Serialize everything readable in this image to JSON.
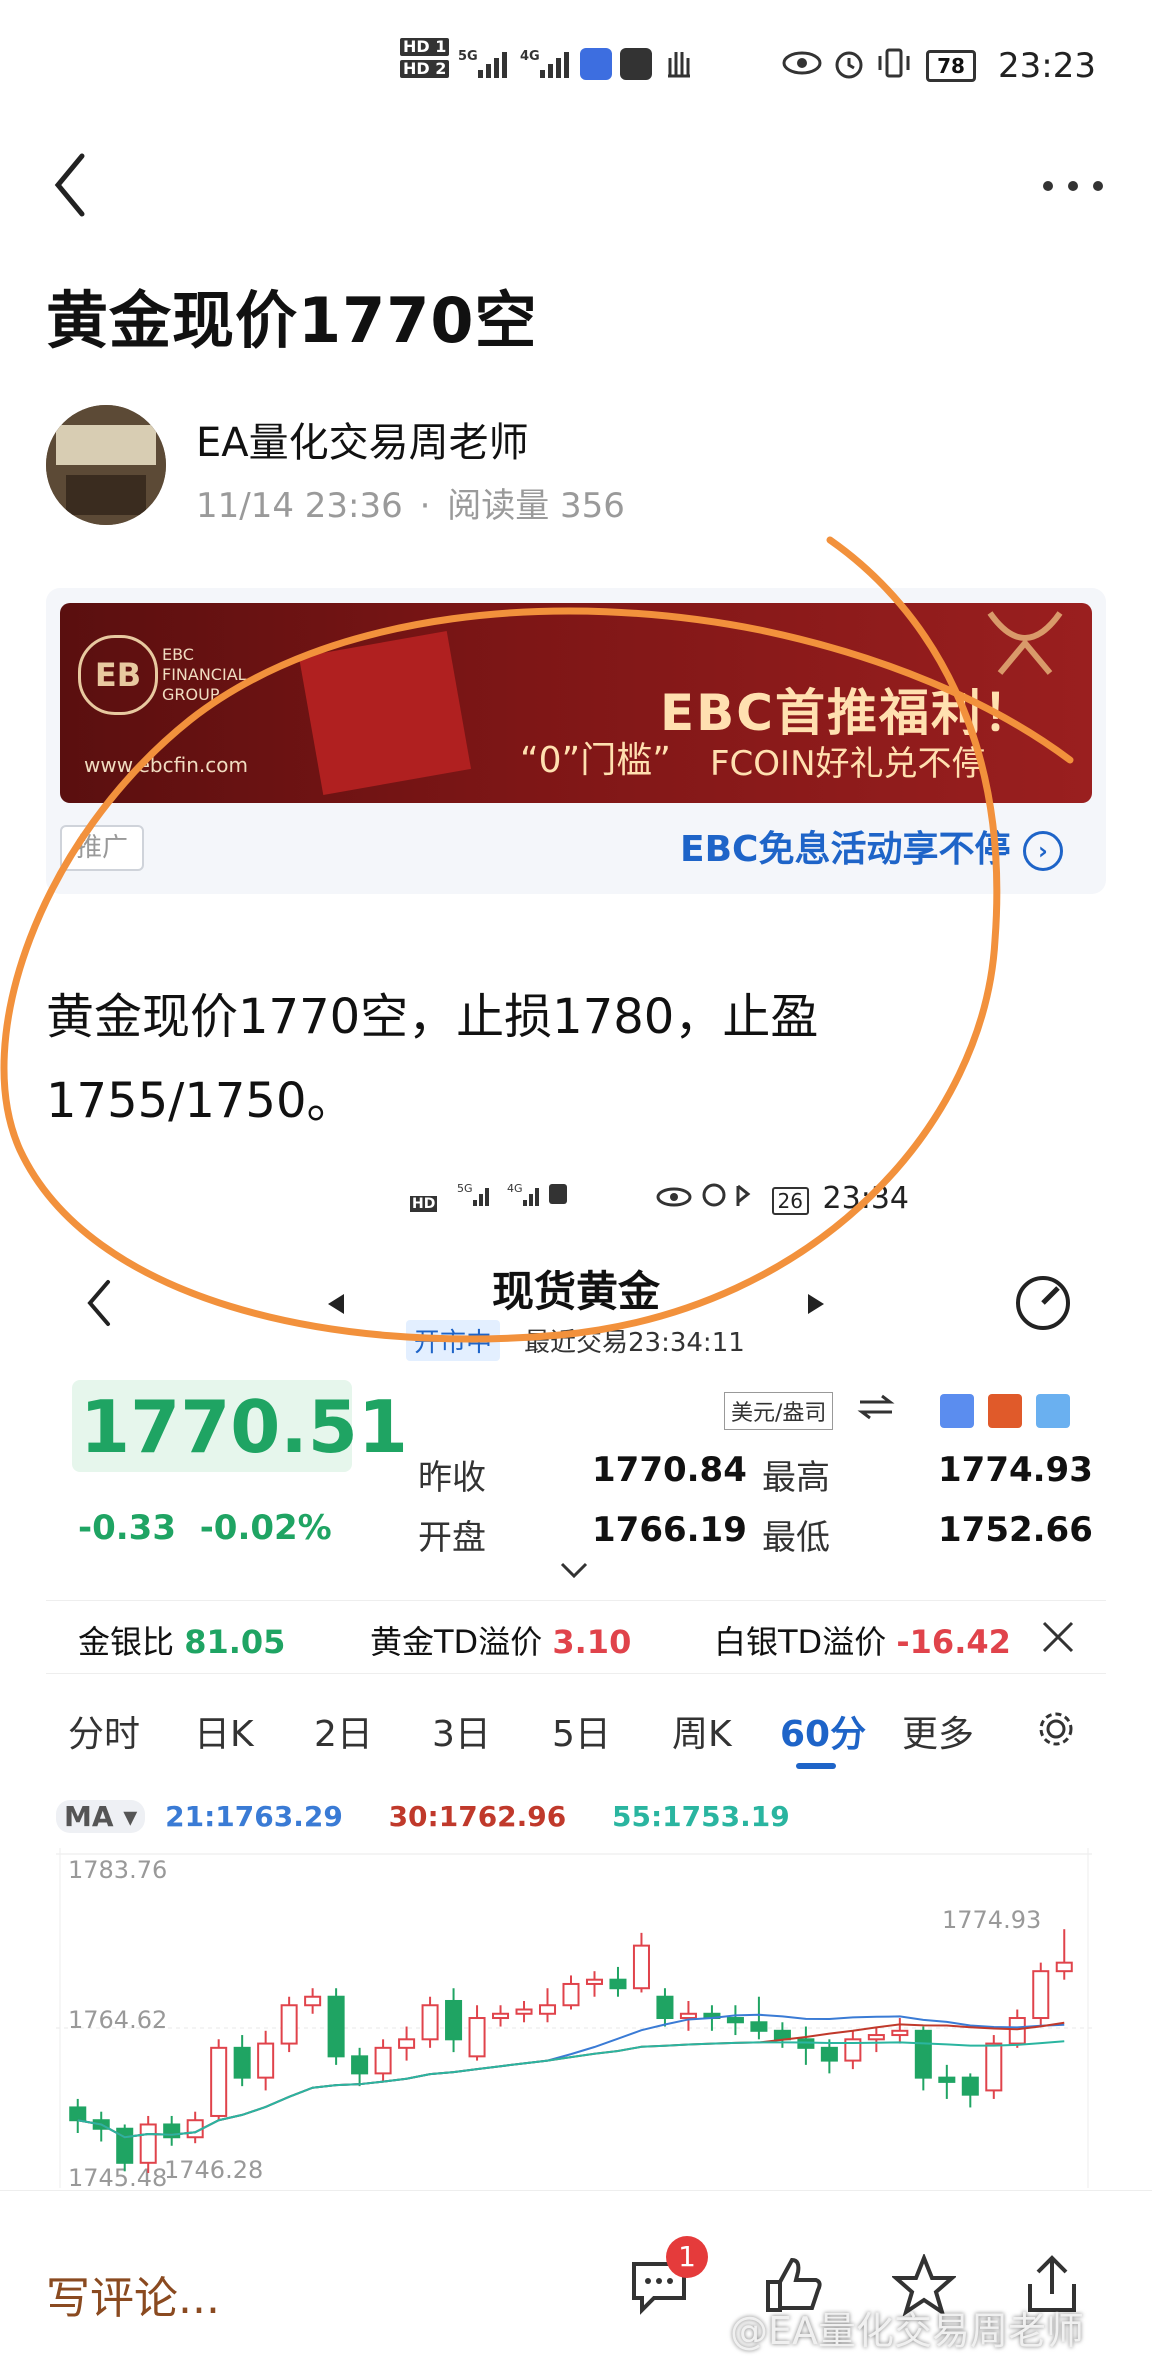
{
  "status_bar": {
    "time": "23:23",
    "battery": "78",
    "hd1": "HD 1",
    "hd2": "HD 2",
    "net1": "5G",
    "net2": "4G"
  },
  "article": {
    "title": "黄金现价1770空",
    "author": "EA量化交易周老师",
    "date": "11/14 23:36",
    "reads_label": "阅读量",
    "reads": "356",
    "body": "黄金现价1770空，止损1780，止盈1755/1750。"
  },
  "ad": {
    "brand_line1": "EBC",
    "brand_line2": "FINANCIAL",
    "brand_line3": "GROUP",
    "site": "www.ebcfin.com",
    "headline": "EBC首推福利！",
    "zero": "“0”门槛”",
    "subline": "FCOIN好礼兑不停",
    "tag": "推广",
    "link": "EBC免息活动享不停"
  },
  "quote": {
    "sub_time": "23:34",
    "sub_battery": "26",
    "title": "现货黄金",
    "status": "开市中",
    "last_trade": "最近交易23:34:11",
    "unit": "美元/盎司",
    "price": "1770.51",
    "change": "-0.33",
    "change_pct": "-0.02%",
    "prev_close_label": "昨收",
    "prev_close": "1770.84",
    "high_label": "最高",
    "high": "1774.93",
    "open_label": "开盘",
    "open": "1766.19",
    "low_label": "最低",
    "low": "1752.66",
    "gold_silver_label": "金银比",
    "gold_silver": "81.05",
    "gold_td_label": "黄金TD溢价",
    "gold_td": "3.10",
    "silver_td_label": "白银TD溢价",
    "silver_td": "-16.42"
  },
  "tabs": [
    "分时",
    "日K",
    "2日",
    "3日",
    "5日",
    "周K",
    "60分",
    "更多"
  ],
  "active_tab": "60分",
  "ma": {
    "label": "MA",
    "ma21": "21:1763.29",
    "ma30": "30:1762.96",
    "ma55": "55:1753.19"
  },
  "chart_data": {
    "type": "candlestick",
    "y_ticks": [
      "1783.76",
      "1764.62",
      "1745.48"
    ],
    "annotations": {
      "high": "1774.93",
      "low": "1746.28"
    },
    "ylim": [
      1745.48,
      1783.76
    ],
    "candles": [
      {
        "o": 1754.0,
        "c": 1752.5,
        "h": 1755.0,
        "l": 1751.0
      },
      {
        "o": 1752.5,
        "c": 1751.5,
        "h": 1753.5,
        "l": 1750.0
      },
      {
        "o": 1751.5,
        "c": 1747.5,
        "h": 1752.0,
        "l": 1746.5
      },
      {
        "o": 1747.5,
        "c": 1752.0,
        "h": 1753.0,
        "l": 1746.3
      },
      {
        "o": 1752.0,
        "c": 1750.5,
        "h": 1753.0,
        "l": 1749.5
      },
      {
        "o": 1750.5,
        "c": 1752.5,
        "h": 1753.5,
        "l": 1749.8
      },
      {
        "o": 1753.0,
        "c": 1761.0,
        "h": 1762.0,
        "l": 1752.5
      },
      {
        "o": 1761.0,
        "c": 1757.5,
        "h": 1762.5,
        "l": 1756.5
      },
      {
        "o": 1757.5,
        "c": 1761.5,
        "h": 1763.0,
        "l": 1756.0
      },
      {
        "o": 1761.5,
        "c": 1766.0,
        "h": 1767.0,
        "l": 1760.5
      },
      {
        "o": 1766.0,
        "c": 1767.0,
        "h": 1768.0,
        "l": 1765.0
      },
      {
        "o": 1767.0,
        "c": 1760.0,
        "h": 1768.0,
        "l": 1759.0
      },
      {
        "o": 1760.0,
        "c": 1758.0,
        "h": 1761.0,
        "l": 1756.5
      },
      {
        "o": 1758.0,
        "c": 1761.0,
        "h": 1762.0,
        "l": 1757.0
      },
      {
        "o": 1761.0,
        "c": 1762.0,
        "h": 1763.5,
        "l": 1759.5
      },
      {
        "o": 1762.0,
        "c": 1766.0,
        "h": 1767.0,
        "l": 1761.0
      },
      {
        "o": 1766.5,
        "c": 1762.0,
        "h": 1768.0,
        "l": 1760.5
      },
      {
        "o": 1760.0,
        "c": 1764.5,
        "h": 1766.0,
        "l": 1759.5
      },
      {
        "o": 1764.5,
        "c": 1765.0,
        "h": 1766.0,
        "l": 1763.5
      },
      {
        "o": 1765.0,
        "c": 1765.5,
        "h": 1766.5,
        "l": 1764.0
      },
      {
        "o": 1765.0,
        "c": 1766.0,
        "h": 1768.0,
        "l": 1764.0
      },
      {
        "o": 1766.0,
        "c": 1768.5,
        "h": 1769.5,
        "l": 1765.5
      },
      {
        "o": 1768.5,
        "c": 1769.0,
        "h": 1770.0,
        "l": 1767.0
      },
      {
        "o": 1769.0,
        "c": 1768.0,
        "h": 1770.5,
        "l": 1767.0
      },
      {
        "o": 1768.0,
        "c": 1773.0,
        "h": 1774.5,
        "l": 1767.5
      },
      {
        "o": 1767.0,
        "c": 1764.5,
        "h": 1768.0,
        "l": 1763.5
      },
      {
        "o": 1764.5,
        "c": 1765.0,
        "h": 1766.5,
        "l": 1763.0
      },
      {
        "o": 1765.0,
        "c": 1764.5,
        "h": 1766.0,
        "l": 1763.0
      },
      {
        "o": 1764.5,
        "c": 1764.0,
        "h": 1766.0,
        "l": 1762.5
      },
      {
        "o": 1764.0,
        "c": 1763.0,
        "h": 1767.0,
        "l": 1762.0
      },
      {
        "o": 1763.0,
        "c": 1762.0,
        "h": 1764.0,
        "l": 1761.0
      },
      {
        "o": 1762.0,
        "c": 1761.0,
        "h": 1763.5,
        "l": 1759.0
      },
      {
        "o": 1761.0,
        "c": 1759.5,
        "h": 1762.0,
        "l": 1758.0
      },
      {
        "o": 1759.5,
        "c": 1762.0,
        "h": 1763.0,
        "l": 1758.5
      },
      {
        "o": 1762.0,
        "c": 1762.5,
        "h": 1763.5,
        "l": 1760.5
      },
      {
        "o": 1762.5,
        "c": 1763.0,
        "h": 1764.5,
        "l": 1761.5
      },
      {
        "o": 1763.0,
        "c": 1757.5,
        "h": 1763.5,
        "l": 1756.0
      },
      {
        "o": 1757.5,
        "c": 1757.0,
        "h": 1759.0,
        "l": 1755.0
      },
      {
        "o": 1757.5,
        "c": 1755.5,
        "h": 1758.0,
        "l": 1754.0
      },
      {
        "o": 1756.0,
        "c": 1761.5,
        "h": 1762.5,
        "l": 1755.0
      },
      {
        "o": 1761.5,
        "c": 1764.5,
        "h": 1765.5,
        "l": 1761.0
      },
      {
        "o": 1764.5,
        "c": 1770.0,
        "h": 1771.0,
        "l": 1763.5
      },
      {
        "o": 1770.0,
        "c": 1771.0,
        "h": 1774.93,
        "l": 1769.0
      }
    ]
  },
  "bottom": {
    "comment_placeholder": "写评论...",
    "badge": "1",
    "watermark": "@EA量化交易周老师"
  }
}
